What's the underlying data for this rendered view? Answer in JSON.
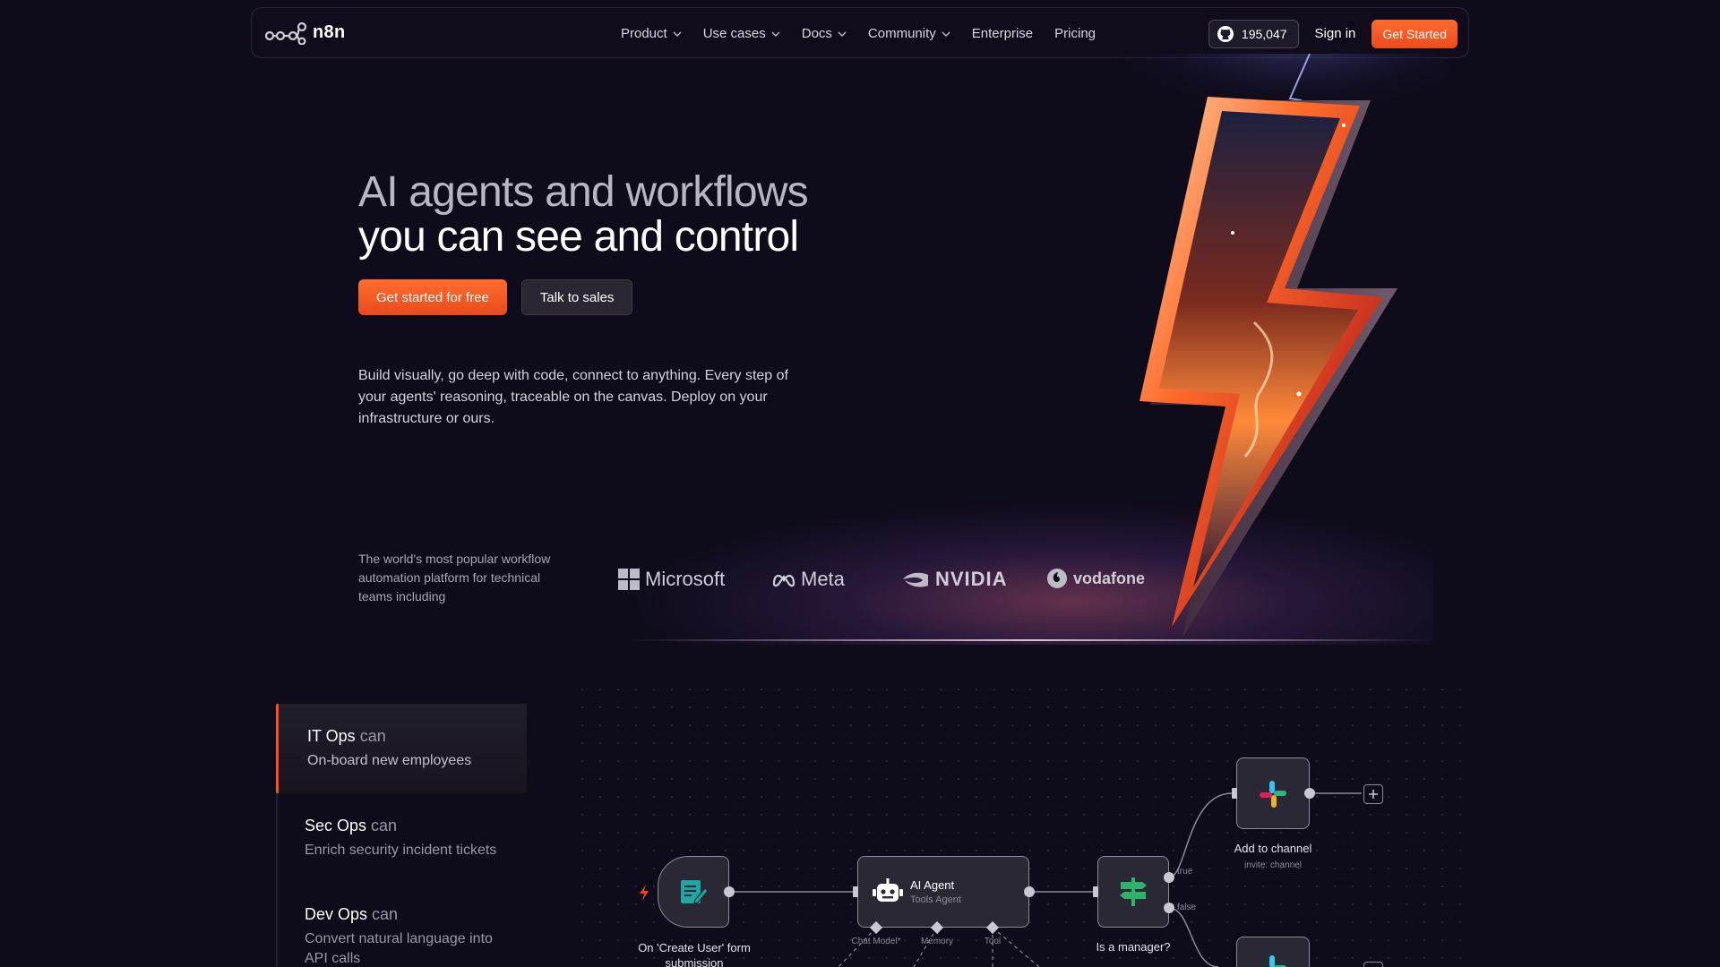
{
  "nav": {
    "logo_text": "n8n",
    "links": [
      {
        "label": "Product",
        "dropdown": true
      },
      {
        "label": "Use cases",
        "dropdown": true
      },
      {
        "label": "Docs",
        "dropdown": true
      },
      {
        "label": "Community",
        "dropdown": true
      },
      {
        "label": "Enterprise",
        "dropdown": false
      },
      {
        "label": "Pricing",
        "dropdown": false
      }
    ],
    "github_stars": "195,047",
    "sign_in": "Sign in",
    "get_started": "Get Started"
  },
  "hero": {
    "title_line1": "AI agents and workflows",
    "title_line2": "you can see and control",
    "primary_cta": "Get started for free",
    "secondary_cta": "Talk to sales",
    "description": "Build visually, go deep with code, connect to anything. Every step of your agents' reasoning, traceable on the canvas. Deploy on your infrastructure or ours."
  },
  "trust": {
    "text": "The world's most popular workflow automation platform for technical teams including",
    "brands": [
      "Microsoft",
      "Meta",
      "NVIDIA",
      "vodafone"
    ]
  },
  "use_cases": [
    {
      "team": "IT Ops",
      "can": "can",
      "task": "On-board new employees",
      "active": true
    },
    {
      "team": "Sec Ops",
      "can": "can",
      "task": "Enrich security incident tickets",
      "active": false
    },
    {
      "team": "Dev Ops",
      "can": "can",
      "task": "Convert natural language into API calls",
      "active": false
    }
  ],
  "workflow": {
    "trigger_label": "On 'Create User' form submission",
    "agent_title": "AI Agent",
    "agent_sub": "Tools Agent",
    "agent_ports": [
      "Chat Model*",
      "Memory",
      "Tool"
    ],
    "condition_label": "Is a manager?",
    "branch_true": "true",
    "branch_false": "false",
    "slack_label": "Add to channel",
    "slack_sub": "invite: channel"
  },
  "colors": {
    "background": "#0e0b1a",
    "accent": "#ff5b22",
    "muted_text": "#9b98a6"
  }
}
